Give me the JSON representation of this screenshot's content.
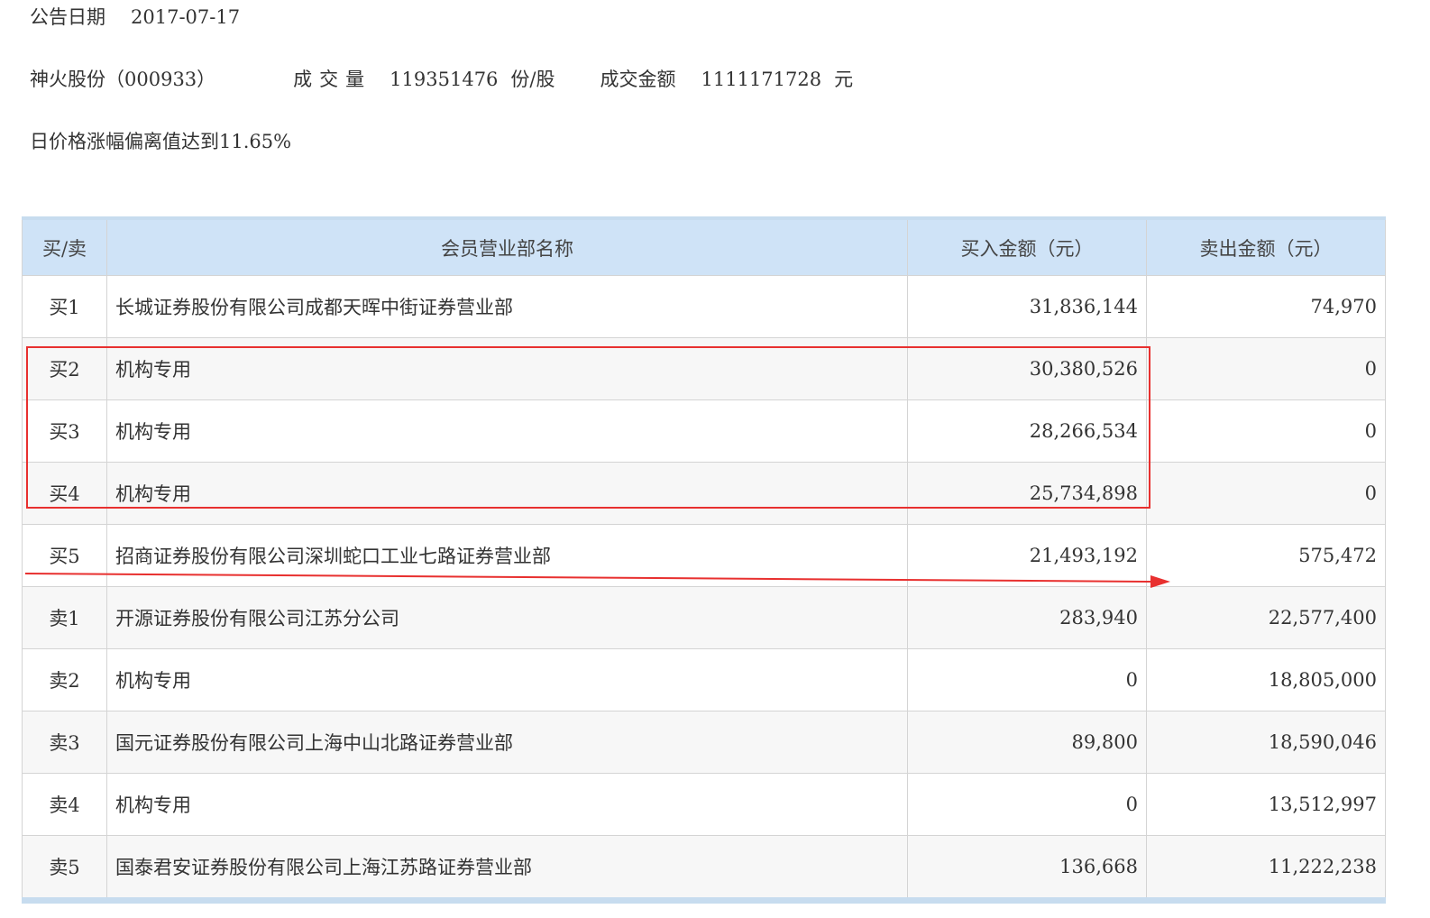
{
  "announcement": {
    "date_label": "公告日期",
    "date_value": "2017-07-17"
  },
  "stock": {
    "name_code": "神火股份（000933）",
    "volume_label": "成交量",
    "volume_value": "119351476",
    "volume_unit": "份/股",
    "amount_label": "成交金额",
    "amount_value": "1111171728",
    "amount_unit": "元"
  },
  "reason": "日价格涨幅偏离值达到11.65%",
  "table": {
    "headers": {
      "side": "买/卖",
      "name": "会员营业部名称",
      "buy": "买入金额（元）",
      "sell": "卖出金额（元）"
    },
    "rows": [
      {
        "side": "买1",
        "name": "长城证券股份有限公司成都天晖中街证券营业部",
        "buy": "31,836,144",
        "sell": "74,970"
      },
      {
        "side": "买2",
        "name": "机构专用",
        "buy": "30,380,526",
        "sell": "0"
      },
      {
        "side": "买3",
        "name": "机构专用",
        "buy": "28,266,534",
        "sell": "0"
      },
      {
        "side": "买4",
        "name": "机构专用",
        "buy": "25,734,898",
        "sell": "0"
      },
      {
        "side": "买5",
        "name": "招商证券股份有限公司深圳蛇口工业七路证券营业部",
        "buy": "21,493,192",
        "sell": "575,472"
      },
      {
        "side": "卖1",
        "name": "开源证券股份有限公司江苏分公司",
        "buy": "283,940",
        "sell": "22,577,400"
      },
      {
        "side": "卖2",
        "name": "机构专用",
        "buy": "0",
        "sell": "18,805,000"
      },
      {
        "side": "卖3",
        "name": "国元证券股份有限公司上海中山北路证券营业部",
        "buy": "89,800",
        "sell": "18,590,046"
      },
      {
        "side": "卖4",
        "name": "机构专用",
        "buy": "0",
        "sell": "13,512,997"
      },
      {
        "side": "卖5",
        "name": "国泰君安证券股份有限公司上海江苏路证券营业部",
        "buy": "136,668",
        "sell": "11,222,238"
      }
    ]
  },
  "annotations": {
    "color": "#e8302f"
  }
}
